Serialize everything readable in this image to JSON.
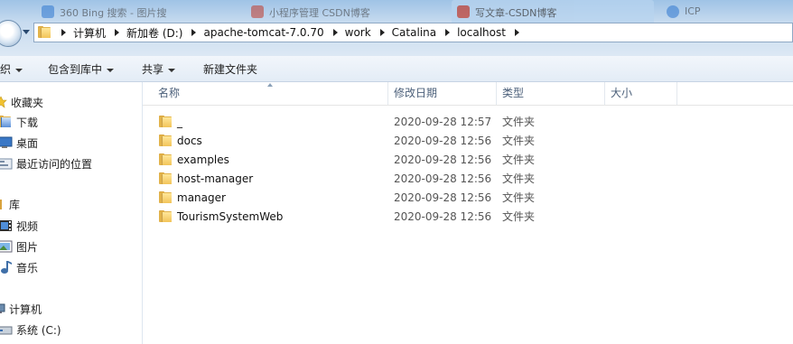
{
  "browser_tabs": [
    {
      "title": "360 Bing 搜索 - 图片搜",
      "color": "#2e77d0"
    },
    {
      "title": "小程序管理 CSDN博客",
      "color": "#c0392b"
    },
    {
      "title": "写文章-CSDN博客",
      "color": "#c0392b"
    },
    {
      "title": "ICP",
      "color": "#2e77d0"
    }
  ],
  "address": {
    "crumbs": [
      "计算机",
      "新加卷 (D:)",
      "apache-tomcat-7.0.70",
      "work",
      "Catalina",
      "localhost"
    ]
  },
  "toolbar": {
    "organize_label": "织",
    "include_label": "包含到库中",
    "share_label": "共享",
    "new_folder_label": "新建文件夹"
  },
  "nav": {
    "favorites_label": "收藏夹",
    "download_label": "下载",
    "desktop_label": "桌面",
    "recent_label": "最近访问的位置",
    "library_label": "库",
    "video_label": "视频",
    "pictures_label": "图片",
    "music_label": "音乐",
    "computer_label": "计算机",
    "system_drive_label": "系统 (C:)"
  },
  "columns": {
    "name": "名称",
    "date": "修改日期",
    "type": "类型",
    "size": "大小"
  },
  "files": [
    {
      "name": "_",
      "date": "2020-09-28 12:57",
      "type": "文件夹"
    },
    {
      "name": "docs",
      "date": "2020-09-28 12:56",
      "type": "文件夹"
    },
    {
      "name": "examples",
      "date": "2020-09-28 12:56",
      "type": "文件夹"
    },
    {
      "name": "host-manager",
      "date": "2020-09-28 12:56",
      "type": "文件夹"
    },
    {
      "name": "manager",
      "date": "2020-09-28 12:56",
      "type": "文件夹"
    },
    {
      "name": "TourismSystemWeb",
      "date": "2020-09-28 12:56",
      "type": "文件夹"
    }
  ]
}
